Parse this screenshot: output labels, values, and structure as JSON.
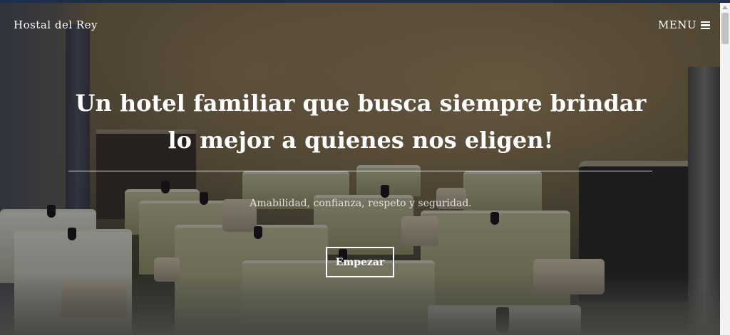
{
  "nav": {
    "brand": "Hostal del Rey",
    "menu_label": "MENU",
    "menu_icon": "hamburger-icon"
  },
  "hero": {
    "title": "Un hotel familiar que busca siempre brindar lo mejor a quienes nos eligen!",
    "subtitle": "Amabilidad, confianza, respeto y seguridad.",
    "cta_label": "Empezar"
  },
  "colors": {
    "text": "#ffffff",
    "top_strip": "#1f2f4a"
  }
}
